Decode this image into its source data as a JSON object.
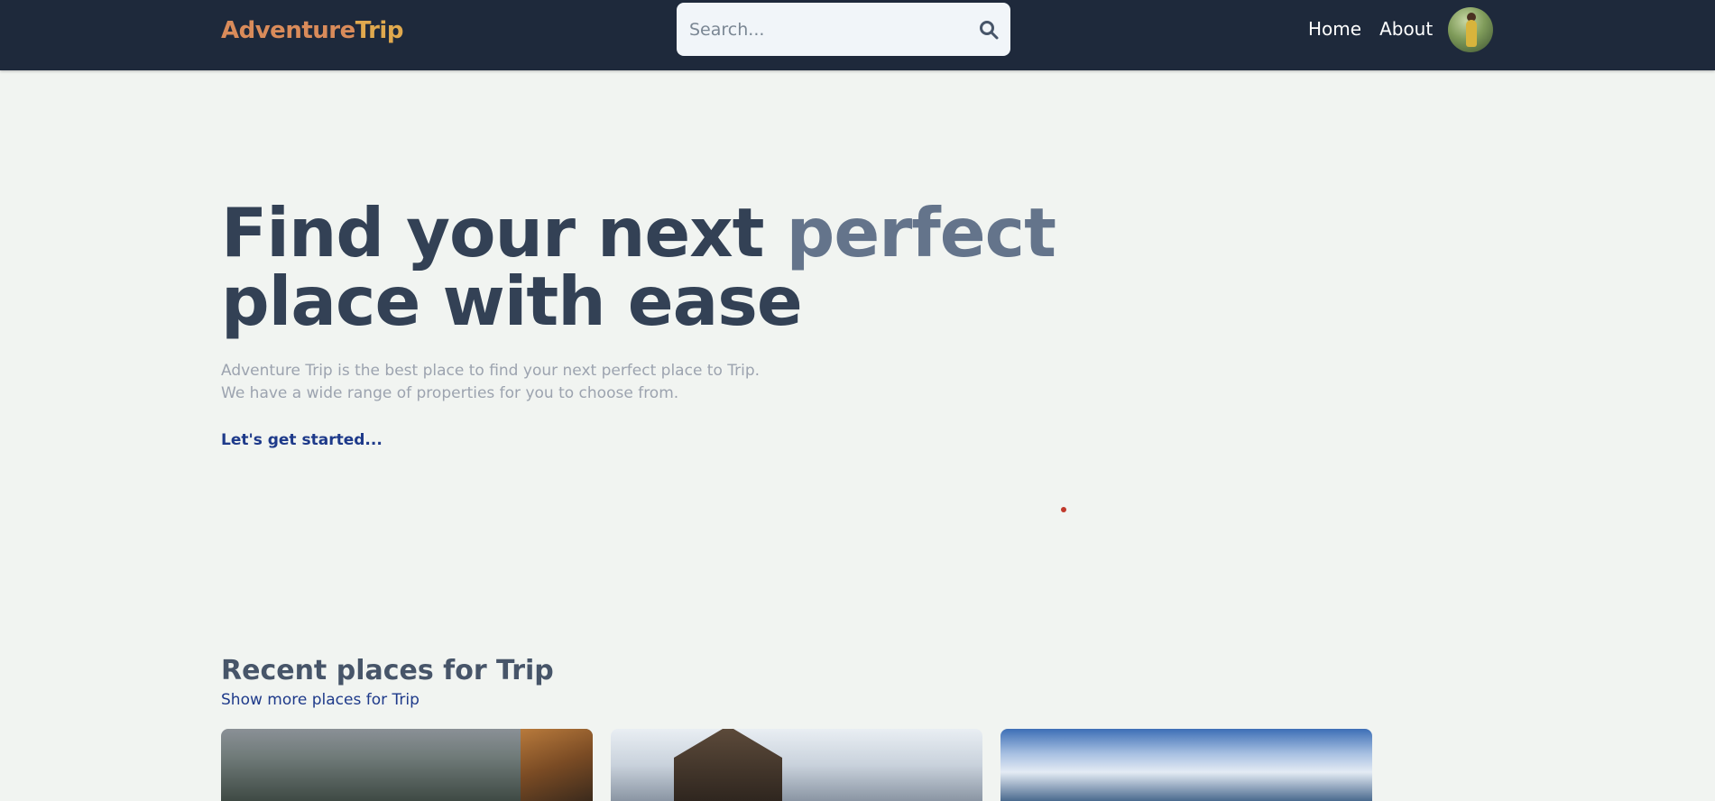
{
  "header": {
    "brand_part1": "Adventure",
    "brand_part2": "Trip",
    "search_placeholder": "Search...",
    "search_icon": "search-icon",
    "nav": [
      {
        "label": "Home"
      },
      {
        "label": "About"
      }
    ],
    "avatar": "profile-avatar"
  },
  "hero": {
    "title_part1": "Find your next ",
    "title_accent": "perfect",
    "title_part2": "place with ease",
    "desc_line1": "Adventure Trip is the best place to find your next perfect place to Trip.",
    "desc_line2": "We have a wide range of properties for you to choose from.",
    "cta": "Let's get started..."
  },
  "recent": {
    "title": "Recent places for Trip",
    "more_link": "Show more places for Trip"
  },
  "colors": {
    "navbar_bg": "#1e293b",
    "page_bg": "#f1f4f1",
    "brand_a": "#d98b5a",
    "brand_b": "#e0a94e",
    "heading": "#334155",
    "accent": "#64748b",
    "link": "#1e3a8a"
  }
}
